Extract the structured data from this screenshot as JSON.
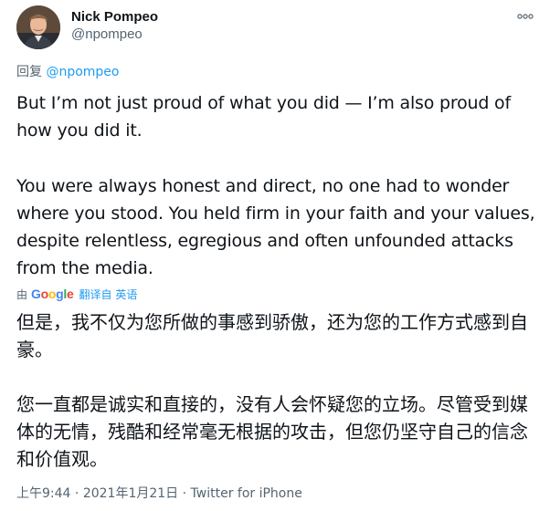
{
  "author": {
    "display_name": "Nick Pompeo",
    "handle": "@npompeo"
  },
  "reply": {
    "prefix": "回复 ",
    "mention": "@npompeo"
  },
  "tweet_text_en": [
    "But I’m not just proud of what you did — I’m also proud of how you did it.",
    "You were always honest and direct, no one had to wonder where you stood. You held firm in your faith and your values, despite relentless, egregious and often unfounded attacks from the media."
  ],
  "translation": {
    "by_label": "由",
    "provider": "Google",
    "translated_from": "翻译自 英语"
  },
  "tweet_text_zh": [
    "但是，我不仅为您所做的事感到骄傲，还为您的工作方式感到自豪。",
    "您一直都是诚实和直接的，没有人会怀疑您的立场。尽管受到媒体的无情，残酷和经常毫无根据的攻击，但您仍坚守自己的信念和价值观。"
  ],
  "meta": {
    "time": "上午9:44",
    "separator": " · ",
    "date": "2021年1月21日",
    "source": "Twitter for iPhone"
  },
  "icons": {
    "more": "more-horizontal-icon",
    "avatar": "profile-avatar"
  }
}
